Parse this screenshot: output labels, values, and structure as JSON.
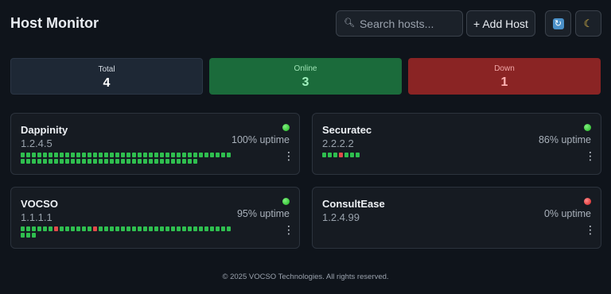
{
  "header": {
    "title": "Host Monitor",
    "search_placeholder": "Search hosts...",
    "search_icon": "search-icon",
    "add_label": "+ Add Host",
    "refresh_icon": "refresh-icon",
    "theme_icon": "moon-icon"
  },
  "stats": {
    "total_label": "Total",
    "total_value": "4",
    "online_label": "Online",
    "online_value": "3",
    "down_label": "Down",
    "down_value": "1"
  },
  "hosts": [
    {
      "name": "Dappinity",
      "ip": "1.2.4.5",
      "status": "up",
      "uptime": "100% uptime",
      "heartbeats": [
        1,
        1,
        1,
        1,
        1,
        1,
        1,
        1,
        1,
        1,
        1,
        1,
        1,
        1,
        1,
        1,
        1,
        1,
        1,
        1,
        1,
        1,
        1,
        1,
        1,
        1,
        1,
        1,
        1,
        1,
        1,
        1,
        1,
        1,
        1,
        1,
        1,
        1,
        1,
        1,
        1,
        1,
        1,
        1,
        1,
        1,
        1,
        1,
        1,
        1,
        1,
        1,
        1,
        1,
        1,
        1,
        1,
        1,
        1,
        1,
        1,
        1,
        1,
        1,
        1,
        1,
        1,
        1,
        1,
        1
      ]
    },
    {
      "name": "Securatec",
      "ip": "2.2.2.2",
      "status": "up",
      "uptime": "86% uptime",
      "heartbeats": [
        1,
        1,
        1,
        0,
        1,
        1,
        1
      ]
    },
    {
      "name": "VOCSO",
      "ip": "1.1.1.1",
      "status": "up",
      "uptime": "95% uptime",
      "heartbeats": [
        1,
        1,
        1,
        1,
        1,
        1,
        0,
        1,
        1,
        1,
        1,
        1,
        1,
        0,
        1,
        1,
        1,
        1,
        1,
        1,
        1,
        1,
        1,
        1,
        1,
        1,
        1,
        1,
        1,
        1,
        1,
        1,
        1,
        1,
        1,
        1,
        1,
        1,
        1,
        1,
        1
      ]
    },
    {
      "name": "ConsultEase",
      "ip": "1.2.4.99",
      "status": "down",
      "uptime": "0% uptime",
      "heartbeats": []
    }
  ],
  "colors": {
    "up": "#2fbf4f",
    "down": "#e24a4a",
    "online_bg": "#1b6b3b",
    "down_bg": "#8a2424"
  },
  "footer": "© 2025 VOCSO Technologies. All rights reserved."
}
